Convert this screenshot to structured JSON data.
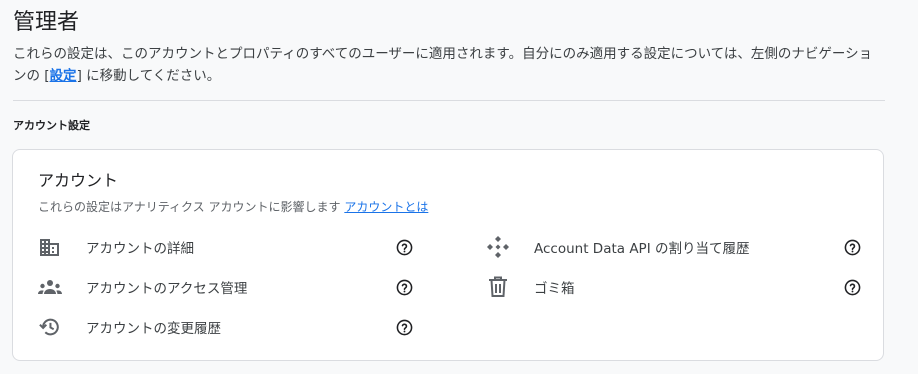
{
  "page": {
    "title": "管理者",
    "description_before_link": "これらの設定は、このアカウントとプロパティのすべてのユーザーに適用されます。自分にのみ適用する設定については、左側のナビゲーションの [",
    "description_link": "設定",
    "description_after_link": "] に移動してください。"
  },
  "section": {
    "label": "アカウント設定"
  },
  "card": {
    "title": "アカウント",
    "subtitle": "これらの設定はアナリティクス アカウントに影響します",
    "subtitle_link": "アカウントとは",
    "items": [
      {
        "label": "アカウントの詳細",
        "icon": "building-icon"
      },
      {
        "label": "アカウントのアクセス管理",
        "icon": "people-icon"
      },
      {
        "label": "アカウントの変更履歴",
        "icon": "history-icon"
      },
      {
        "label": "Account Data API の割り当て履歴",
        "icon": "api-icon"
      },
      {
        "label": "ゴミ箱",
        "icon": "trash-icon"
      }
    ]
  },
  "colors": {
    "link": "#1a73e8",
    "icon": "#5f6368",
    "text": "#202124"
  }
}
